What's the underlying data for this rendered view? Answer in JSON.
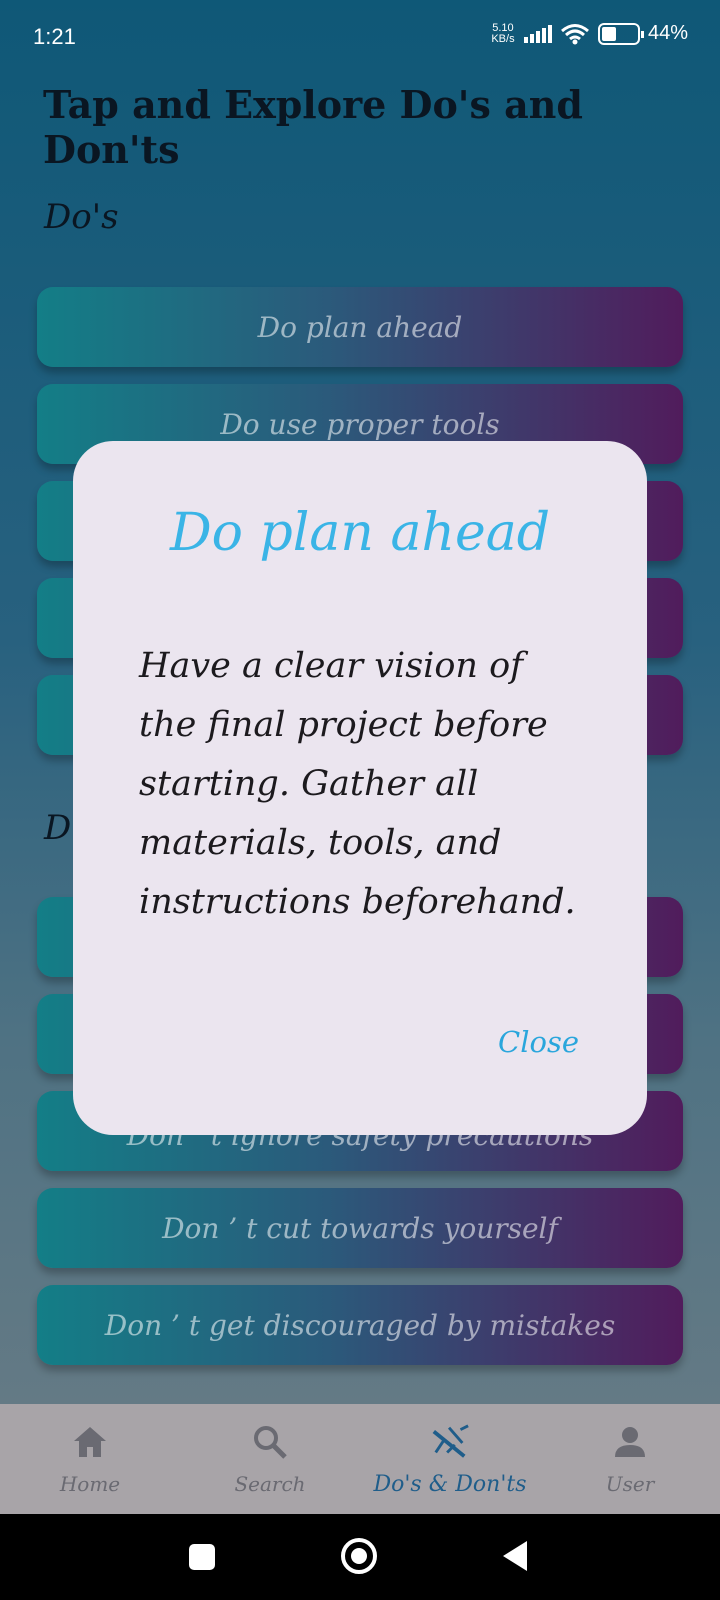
{
  "status_bar": {
    "time": "1:21",
    "net_speed_value": "5.10",
    "net_speed_unit": "KB/s",
    "battery": "44%"
  },
  "page": {
    "title": "Tap and Explore Do's and Don'ts",
    "dos_heading": "Do's",
    "donts_heading": "D"
  },
  "dos": [
    "Do plan ahead",
    "Do use proper tools",
    "",
    "",
    ""
  ],
  "donts": [
    "",
    "",
    "Don ’ t ignore safety precautions",
    "Don ’ t cut towards yourself",
    "Don ’ t get discouraged by mistakes"
  ],
  "dialog": {
    "title": "Do plan ahead",
    "body": "Have a clear vision of the final project before starting. Gather all materials, tools, and instructions beforehand.",
    "close_label": "Close"
  },
  "bottom_nav": {
    "home": "Home",
    "search": "Search",
    "dos_donts": "Do's & Don'ts",
    "user": "User"
  },
  "colors": {
    "accent": "#3ab4e6",
    "nav_active": "#1f5d8a",
    "dialog_bg": "#ebe5ef"
  }
}
